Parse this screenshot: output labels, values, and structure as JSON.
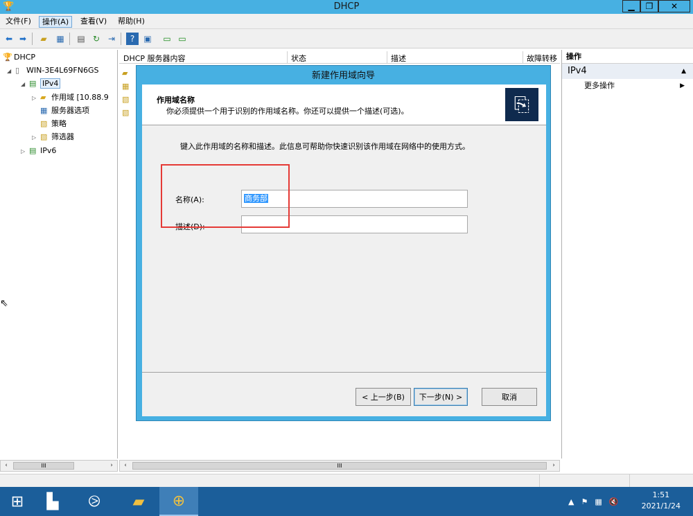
{
  "window": {
    "title": "DHCP",
    "controls": [
      "minimize",
      "restore",
      "close"
    ]
  },
  "menubar": [
    {
      "label": "文件(F)"
    },
    {
      "label": "操作(A)",
      "active": true
    },
    {
      "label": "查看(V)"
    },
    {
      "label": "帮助(H)"
    }
  ],
  "toolbar": {
    "icons": [
      "back-arrow-icon",
      "forward-arrow-icon",
      "up-folder-icon",
      "show-hide-tree-icon",
      "properties-icon",
      "refresh-icon",
      "export-list-icon",
      "help-icon",
      "action-pane-icon",
      "server-icon",
      "monitor-icon"
    ]
  },
  "tree": {
    "items": [
      {
        "label": "DHCP",
        "icon": "dhcp-icon",
        "level": 0,
        "expander": ""
      },
      {
        "label": "WIN-3E4L69FN6GS",
        "icon": "server-icon",
        "level": 1,
        "expander": "◢"
      },
      {
        "label": "IPv4",
        "icon": "ipv4-icon",
        "level": 2,
        "expander": "◢",
        "selected": true
      },
      {
        "label": "作用域 [10.88.9",
        "icon": "folder-icon",
        "level": 3,
        "expander": "▷"
      },
      {
        "label": "服务器选项",
        "icon": "server-options-icon",
        "level": 3,
        "expander": ""
      },
      {
        "label": "策略",
        "icon": "policy-icon",
        "level": 3,
        "expander": ""
      },
      {
        "label": "筛选器",
        "icon": "filter-icon",
        "level": 3,
        "expander": "▷"
      },
      {
        "label": "IPv6",
        "icon": "ipv6-icon",
        "level": 2,
        "expander": "▷"
      }
    ]
  },
  "content": {
    "columns": [
      "DHCP 服务器内容",
      "状态",
      "描述",
      "故障转移"
    ]
  },
  "actions": {
    "header": "操作",
    "section": "IPv4",
    "more": "更多操作"
  },
  "dialog": {
    "title": "新建作用域向导",
    "header_title": "作用域名称",
    "header_desc": "你必须提供一个用于识别的作用域名称。你还可以提供一个描述(可选)。",
    "instruction": "键入此作用域的名称和描述。此信息可帮助你快速识别该作用域在网络中的使用方式。",
    "name_label": "名称(A):",
    "name_value": "商务部",
    "desc_label": "描述(D):",
    "desc_value": "",
    "back_button": "< 上一步(B)",
    "next_button": "下一步(N) >",
    "cancel_button": "取消"
  },
  "taskbar": {
    "icons": [
      "windows-start-icon",
      "server-manager-icon",
      "powershell-icon",
      "file-explorer-icon",
      "dhcp-app-icon"
    ],
    "time": "1:51",
    "date": "2021/1/24"
  }
}
